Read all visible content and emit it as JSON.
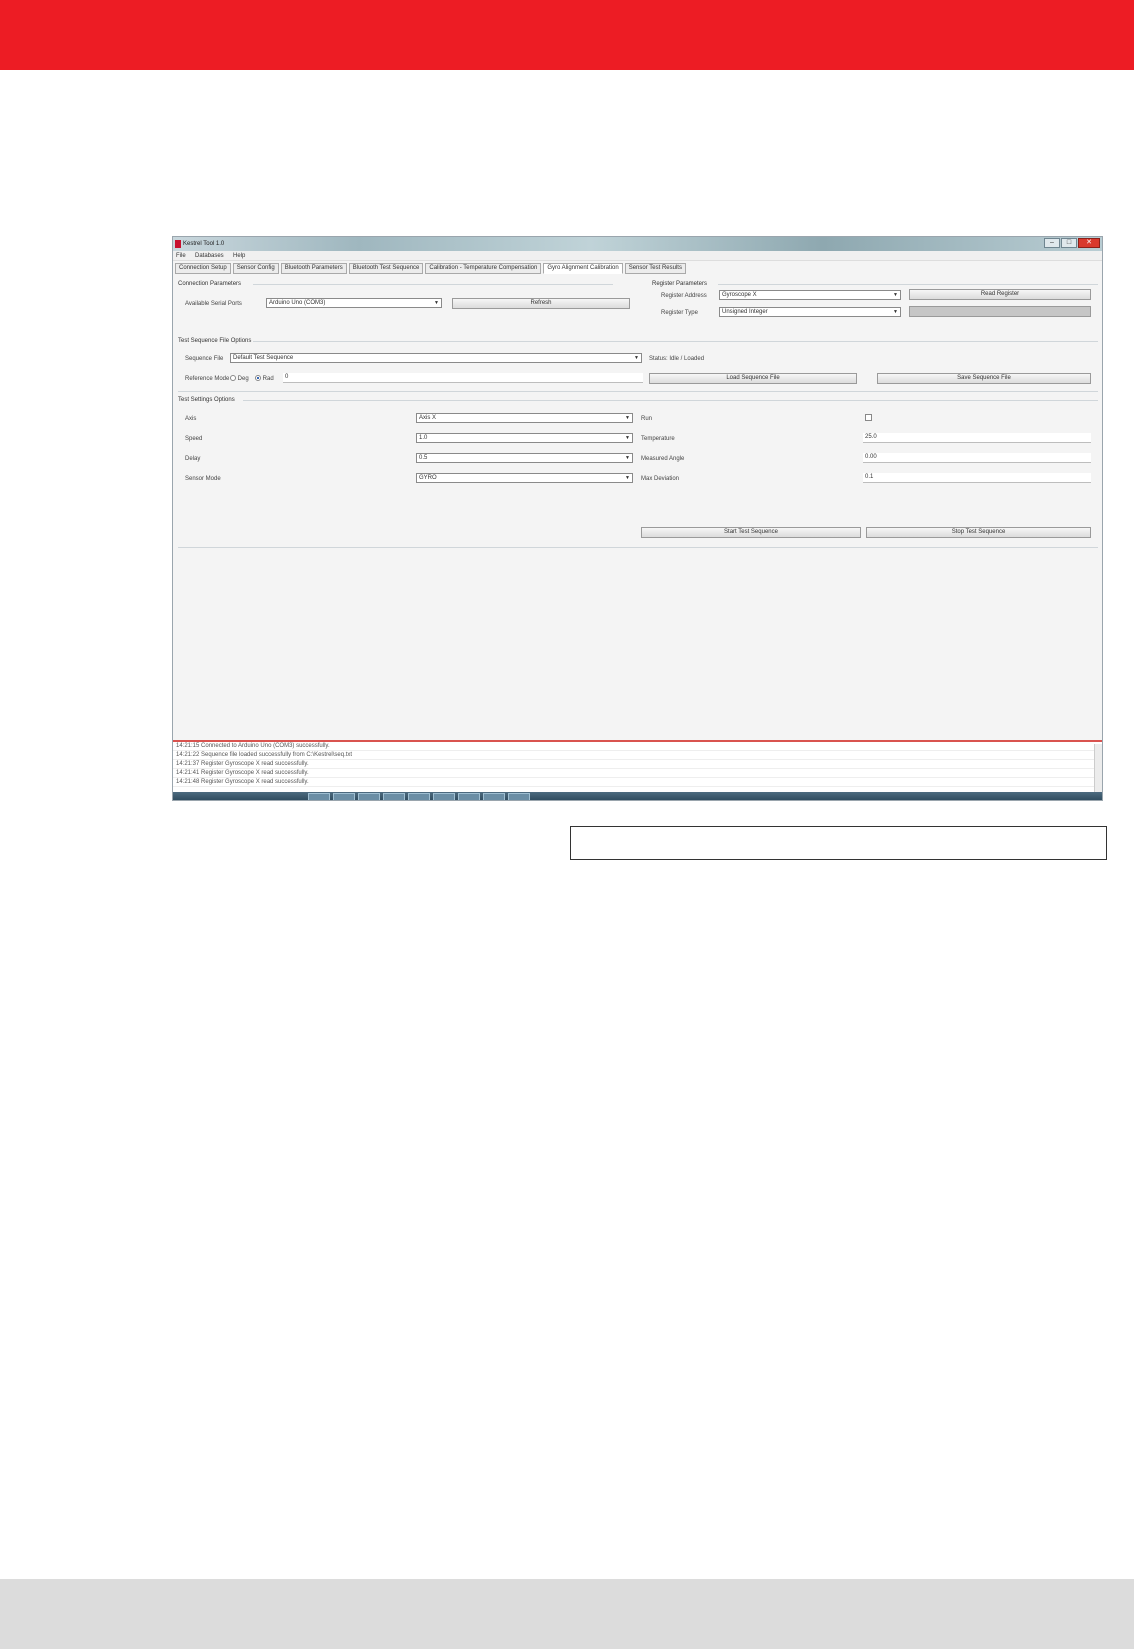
{
  "colors": {
    "brand_red": "#ed1c24",
    "footer_gray": "#dcdcdc"
  },
  "window": {
    "title": "Kestrel Tool 1.0"
  },
  "menu": [
    "File",
    "Databases",
    "Help"
  ],
  "tabs": [
    {
      "label": "Connection Setup"
    },
    {
      "label": "Sensor Config"
    },
    {
      "label": "Bluetooth Parameters"
    },
    {
      "label": "Bluetooth Test Sequence"
    },
    {
      "label": "Calibration - Temperature Compensation"
    },
    {
      "label": "Gyro Alignment Calibration",
      "active": true
    },
    {
      "label": "Sensor Test Results"
    }
  ],
  "connection_group": {
    "title": "Connection Parameters",
    "label": "Available Serial Ports",
    "port_value": "Arduino Uno (COM3)",
    "button": "Refresh"
  },
  "register_group": {
    "title": "Register Parameters",
    "address_label": "Register Address",
    "address_value": "Gyroscope X",
    "read_button": "Read Register",
    "type_label": "Register Type",
    "type_value": "Unsigned Integer",
    "write_button": ""
  },
  "file_group": {
    "title": "Test Sequence File Options",
    "file_label": "Sequence File",
    "file_value": "Default Test Sequence",
    "status_label": "Status: Idle / Loaded",
    "mode_label": "Reference Mode",
    "mode_options": [
      "Deg",
      "Rad"
    ],
    "value": "0",
    "load_button": "Load Sequence File",
    "save_button": "Save Sequence File"
  },
  "settings_group": {
    "title": "Test Settings Options",
    "rows": [
      {
        "label": "Axis",
        "value": "Axis X"
      },
      {
        "label": "Speed",
        "value": "1.0"
      },
      {
        "label": "Delay",
        "value": "0.5"
      },
      {
        "label": "Sensor Mode",
        "value": "GYRO"
      }
    ],
    "right_rows": [
      {
        "label": "Run",
        "value": ""
      },
      {
        "label": "Temperature",
        "value": "25.0"
      },
      {
        "label": "Measured Angle",
        "value": "0.00"
      },
      {
        "label": "Max Deviation",
        "value": "0.1"
      }
    ],
    "start_button": "Start Test Sequence",
    "stop_button": "Stop Test Sequence"
  },
  "log": [
    "14:21:15 Connected to Arduino Uno (COM3) successfully.",
    "14:21:22 Sequence file loaded successfully from C:\\Kestrel\\seq.txt",
    "14:21:37 Register Gyroscope X read successfully.",
    "14:21:41 Register Gyroscope X read successfully.",
    "14:21:48 Register Gyroscope X read successfully."
  ]
}
